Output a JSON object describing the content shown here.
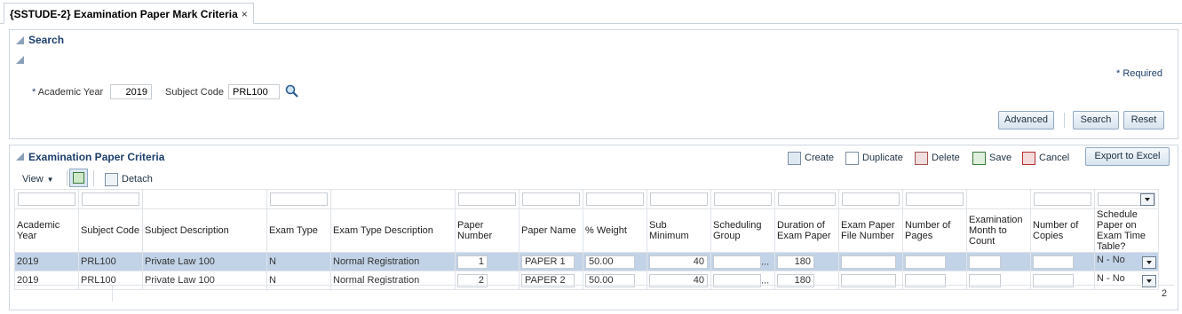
{
  "tab": {
    "title": "{SSTUDE-2} Examination Paper Mark Criteria",
    "close": "×"
  },
  "search": {
    "title": "Search",
    "required_note": "* Required",
    "academic_year_label": "Academic Year",
    "academic_year_required": "*",
    "academic_year_value": "2019",
    "subject_code_label": "Subject Code",
    "subject_code_value": "PRL100",
    "advanced_label": "Advanced",
    "search_label": "Search",
    "reset_label": "Reset"
  },
  "grid": {
    "title": "Examination Paper Criteria",
    "toolbar": {
      "create": "Create",
      "duplicate": "Duplicate",
      "delete": "Delete",
      "save": "Save",
      "cancel": "Cancel",
      "export": "Export to Excel"
    },
    "view_label": "View",
    "detach_label": "Detach",
    "columns": [
      "Academic Year",
      "Subject Code",
      "Subject Description",
      "Exam Type",
      "Exam Type Description",
      "Paper Number",
      "Paper Name",
      "% Weight",
      "Sub Minimum",
      "Scheduling Group",
      "Duration of Exam Paper",
      "Exam Paper File Number",
      "Number of Pages",
      "Examination Month to Count",
      "Number of Copies",
      "Schedule Paper on Exam Time Table?"
    ],
    "rows": [
      {
        "year": "2019",
        "code": "PRL100",
        "desc": "Private Law 100",
        "type": "N",
        "type_desc": "Normal Registration",
        "paper_no": "1",
        "paper_name": "PAPER 1",
        "weight": "50.00",
        "sub_min": "40",
        "sched": "...",
        "duration": "180",
        "file_no": "",
        "pages": "",
        "month": "",
        "copies": "",
        "schedule": "N - No"
      },
      {
        "year": "2019",
        "code": "PRL100",
        "desc": "Private Law 100",
        "type": "N",
        "type_desc": "Normal Registration",
        "paper_no": "2",
        "paper_name": "PAPER 2",
        "weight": "50.00",
        "sub_min": "40",
        "sched": "...",
        "duration": "180",
        "file_no": "",
        "pages": "",
        "month": "",
        "copies": "",
        "schedule": "N - No"
      }
    ],
    "row_count": "2"
  }
}
